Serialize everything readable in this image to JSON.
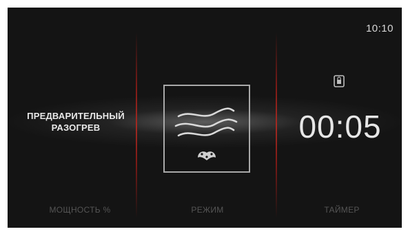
{
  "status": {
    "clock": "10:10"
  },
  "left_panel": {
    "title_line1": "ПРЕДВАРИТЕЛЬНЫЙ",
    "title_line2": "РАЗОГРЕВ"
  },
  "center_panel": {
    "mode_icon": "convection-heat-icon",
    "fan_icon": "fan-icon"
  },
  "right_panel": {
    "lock_icon": "child-lock-icon",
    "timer": "00:05"
  },
  "bottom_nav": {
    "power_label": "МОЩНОСТЬ %",
    "mode_label": "РЕЖИМ",
    "timer_label": "ТАЙМЕР"
  },
  "colors": {
    "background": "#141414",
    "accent_divider": "#a32a22",
    "text_primary": "#e6e6e6",
    "text_muted": "#555555"
  }
}
